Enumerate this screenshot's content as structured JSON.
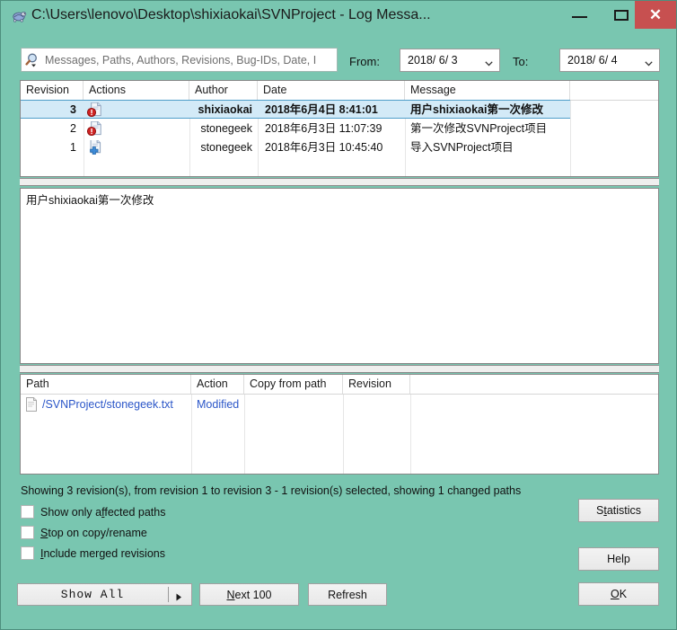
{
  "window": {
    "title": "C:\\Users\\lenovo\\Desktop\\shixiaokai\\SVNProject - Log Messa...",
    "icon": "tortoise-icon",
    "minimize_label": "–",
    "maximize_label": "□",
    "close_label": "✕",
    "bg_color": "#79c6b0",
    "close_color": "#c75050"
  },
  "filter": {
    "search_placeholder": "Messages, Paths, Authors, Revisions, Bug-IDs, Date, I",
    "search_value": "",
    "search_icon": "magnifier-icon",
    "from_label": "From:",
    "from_value": "2018/ 6/ 3",
    "to_label": "To:",
    "to_value": "2018/ 6/ 4"
  },
  "revisions": {
    "columns": [
      "Revision",
      "Actions",
      "Author",
      "Date",
      "Message"
    ],
    "rows": [
      {
        "revision": "3",
        "action_icon": "file-modified-icon",
        "author": "shixiaokai",
        "date": "2018年6月4日 8:41:01",
        "message": "用户shixiaokai第一次修改",
        "selected": true
      },
      {
        "revision": "2",
        "action_icon": "file-modified-icon",
        "author": "stonegeek",
        "date": "2018年6月3日 11:07:39",
        "message": "第一次修改SVNProject项目",
        "selected": false
      },
      {
        "revision": "1",
        "action_icon": "file-added-icon",
        "author": "stonegeek",
        "date": "2018年6月3日 10:45:40",
        "message": "导入SVNProject项目",
        "selected": false
      }
    ]
  },
  "message_pane": {
    "text": "用户shixiaokai第一次修改"
  },
  "paths": {
    "columns": [
      "Path",
      "Action",
      "Copy from path",
      "Revision"
    ],
    "rows": [
      {
        "icon": "text-file-icon",
        "path": "/SVNProject/stonegeek.txt",
        "action": "Modified",
        "copy_from_path": "",
        "revision": "",
        "link_color": "#2b56c8"
      }
    ]
  },
  "status": {
    "text": "Showing 3 revision(s), from revision 1 to revision 3 - 1 revision(s) selected, showing 1 changed paths"
  },
  "options": [
    {
      "label_pre": "Show only a",
      "label_key": "f",
      "label_post": "fected paths",
      "checked": false
    },
    {
      "label_pre": "",
      "label_key": "S",
      "label_post": "top on copy/rename",
      "checked": false
    },
    {
      "label_pre": "",
      "label_key": "I",
      "label_post": "nclude merged revisions",
      "checked": false
    }
  ],
  "buttons": {
    "show_all": "Show All",
    "show_all_arrow": "chevron-right-icon",
    "next_100_pre": "",
    "next_100_key": "N",
    "next_100_post": "ext 100",
    "refresh": "Refresh",
    "statistics_pre": "S",
    "statistics_key": "t",
    "statistics_post": "atistics",
    "help": "Help",
    "ok_key": "O",
    "ok_post": "K"
  }
}
